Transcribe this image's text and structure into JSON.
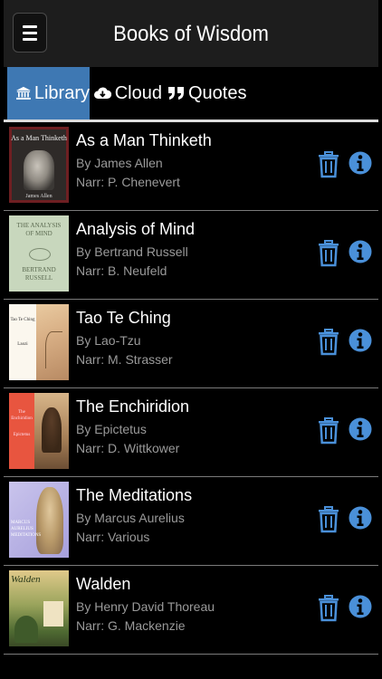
{
  "header": {
    "title": "Books of Wisdom",
    "menu_icon": "hamburger-menu-icon"
  },
  "tabs": [
    {
      "label": "Library",
      "icon": "bank-icon",
      "active": true
    },
    {
      "label": "Cloud",
      "icon": "cloud-download-icon",
      "active": false
    },
    {
      "label": "Quotes",
      "icon": "quote-icon",
      "active": false
    }
  ],
  "books": [
    {
      "title": "As a Man Thinketh",
      "author": "By James Allen",
      "narrator": "Narr: P. Chenevert",
      "cover_title": "As a Man Thinketh",
      "cover_author": "James Allen"
    },
    {
      "title": "Analysis of Mind",
      "author": "By Bertrand Russell",
      "narrator": "Narr: B. Neufeld",
      "cover_title": "THE ANALYSIS OF MIND",
      "cover_author": "BERTRAND RUSSELL"
    },
    {
      "title": "Tao Te Ching",
      "author": "By Lao-Tzu",
      "narrator": "Narr: M. Strasser",
      "cover_title": "Tao Te Ching",
      "cover_author": "Laozi"
    },
    {
      "title": "The Enchiridion",
      "author": "By Epictetus",
      "narrator": "Narr: D. Wittkower",
      "cover_title": "The Enchiridion",
      "cover_author": "Epictetus"
    },
    {
      "title": "The Meditations",
      "author": "By Marcus Aurelius",
      "narrator": "Narr: Various",
      "cover_title": "MARCUS AURELIUS MEDITATIONS",
      "cover_author": ""
    },
    {
      "title": "Walden",
      "author": "By Henry David Thoreau",
      "narrator": "Narr: G. Mackenzie",
      "cover_title": "Walden",
      "cover_author": ""
    }
  ],
  "colors": {
    "accent": "#3e78b3",
    "icon_blue": "#4a90d9",
    "header_bg": "#1d1d1d",
    "muted_text": "#9a9a9a"
  }
}
